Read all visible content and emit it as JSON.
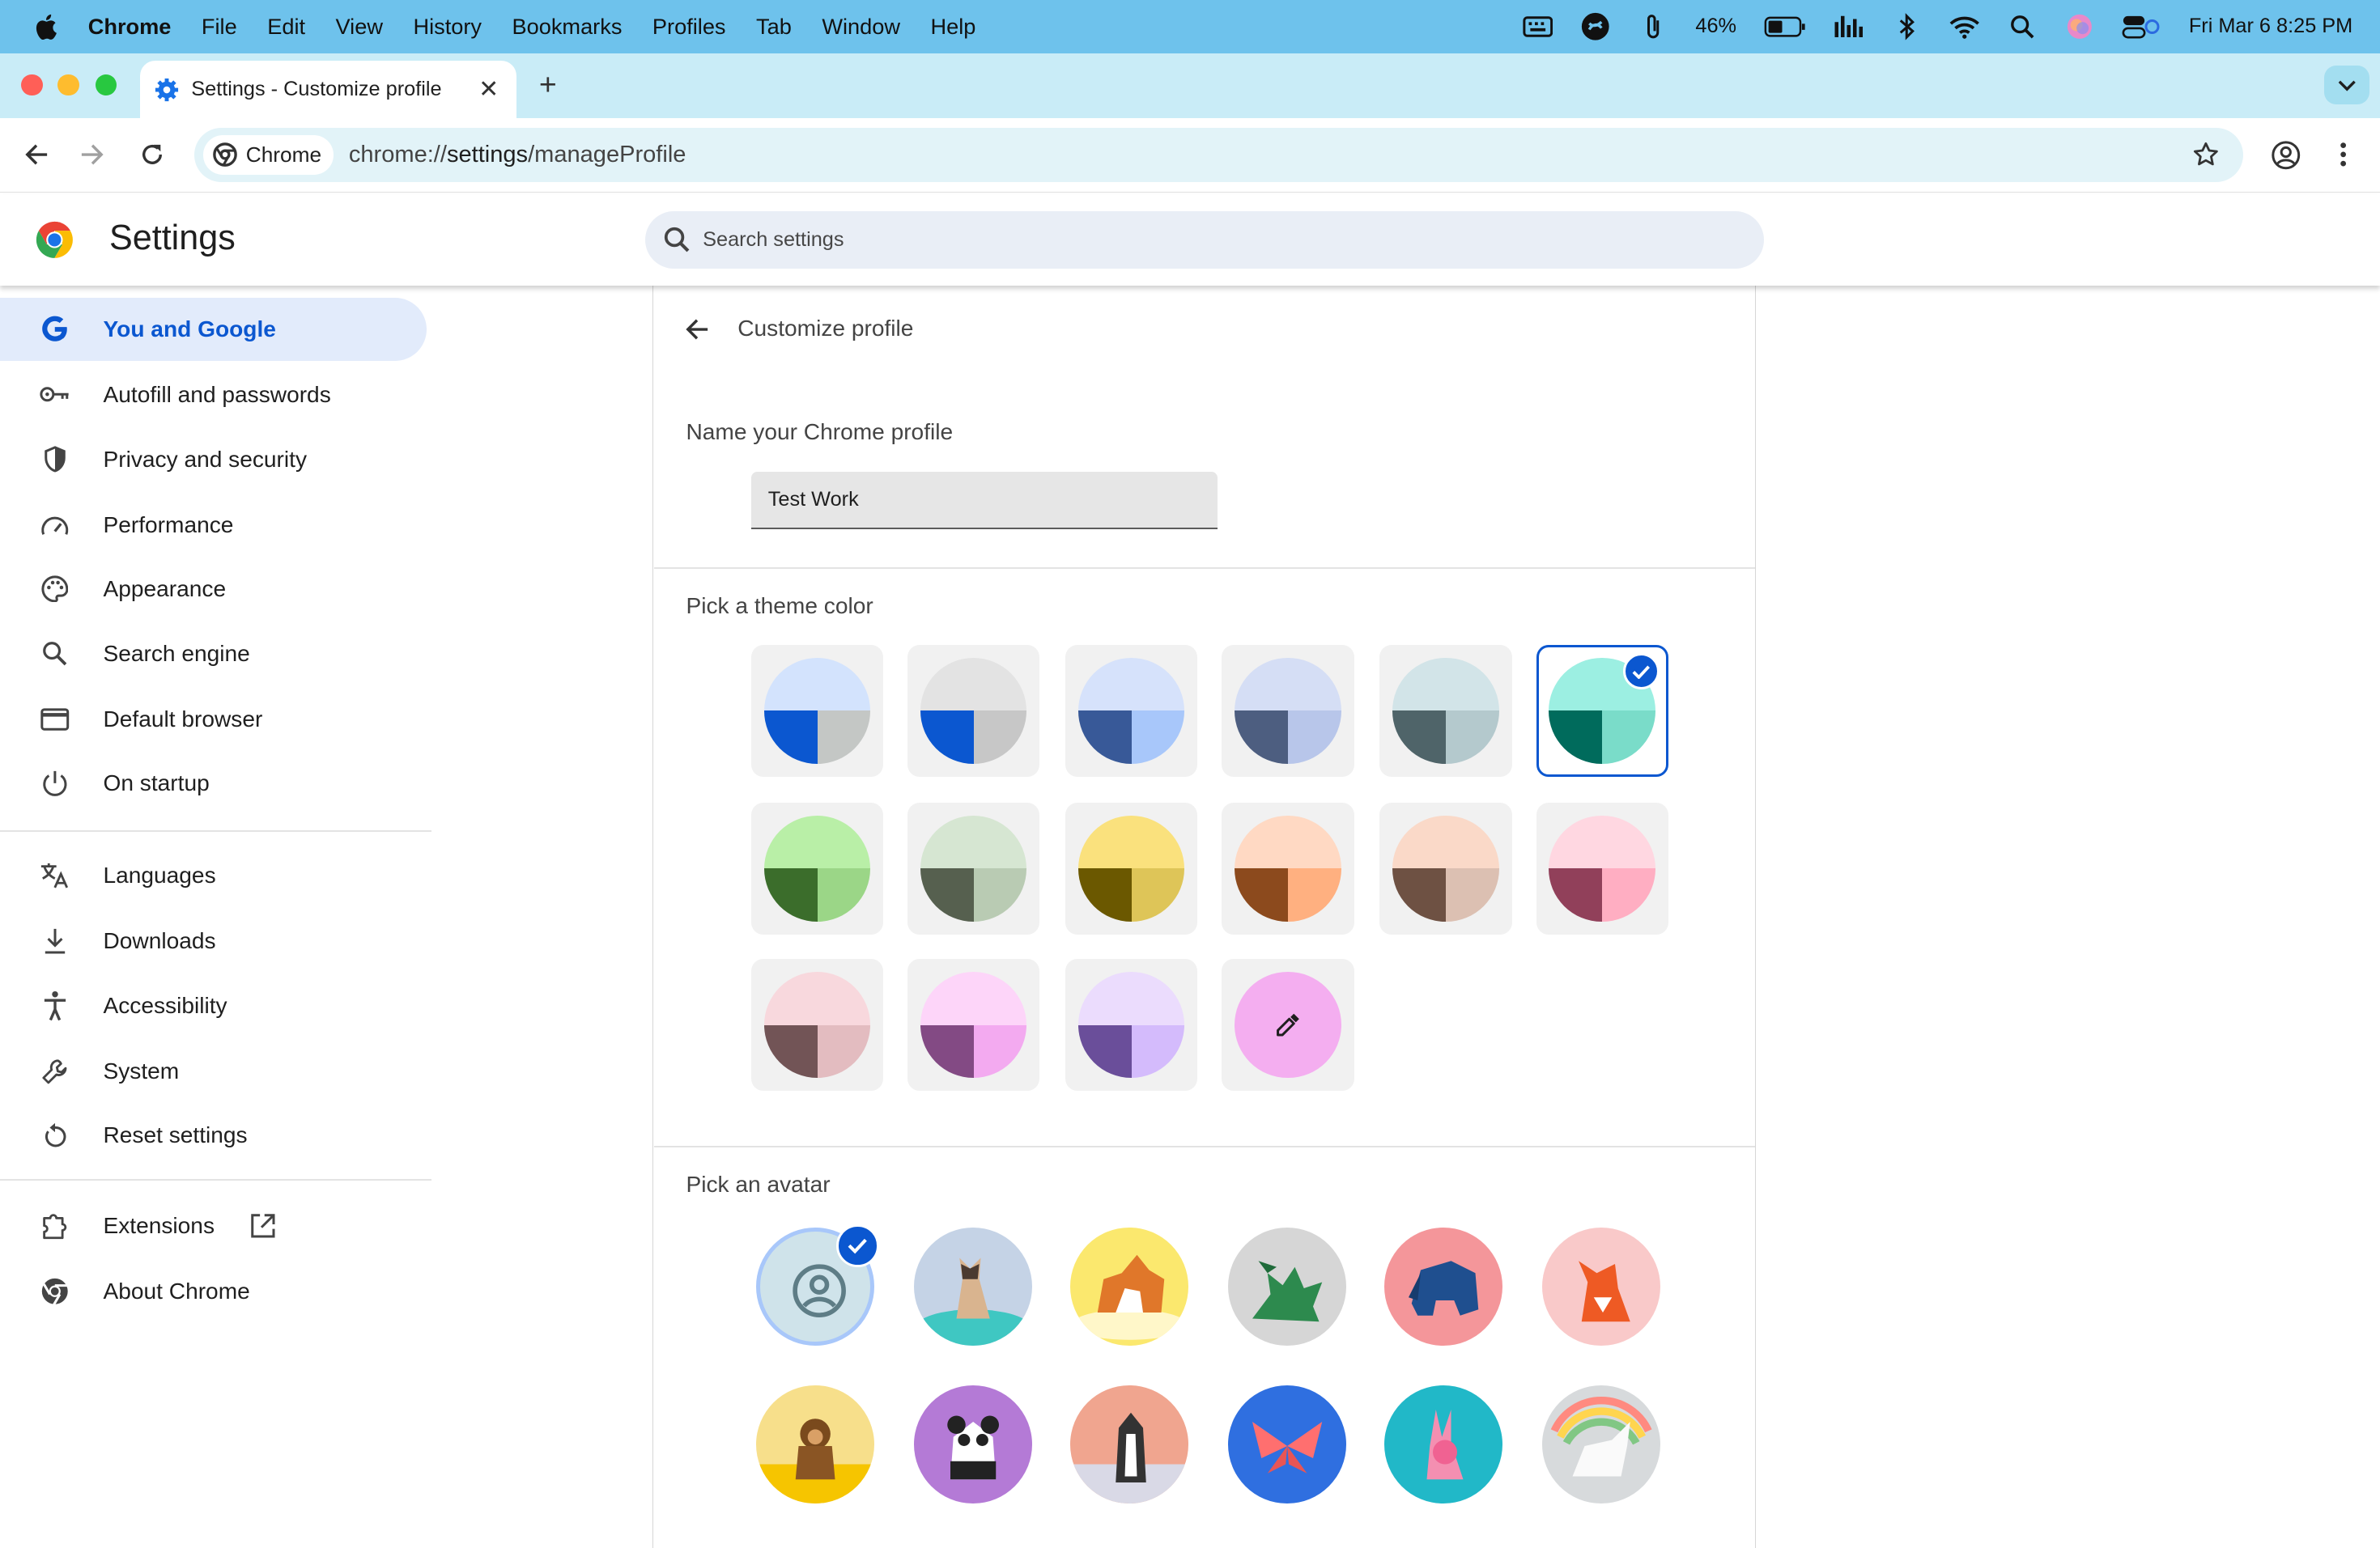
{
  "menubar": {
    "items": [
      "Chrome",
      "File",
      "Edit",
      "View",
      "History",
      "Bookmarks",
      "Profiles",
      "Tab",
      "Window",
      "Help"
    ],
    "battery": "46%",
    "datetime": "Fri Mar 6  8:25 PM"
  },
  "tab": {
    "title": "Settings - Customize profile",
    "close": "✕",
    "new": "+"
  },
  "toolbar": {
    "chip_label": "Chrome",
    "url_prefix": "chrome://",
    "url_host": "settings",
    "url_path": "/manageProfile"
  },
  "header": {
    "title": "Settings",
    "search_placeholder": "Search settings"
  },
  "sidebar": {
    "items": [
      {
        "label": "You and Google",
        "icon": "google-g-icon",
        "active": true
      },
      {
        "label": "Autofill and passwords",
        "icon": "key-icon"
      },
      {
        "label": "Privacy and security",
        "icon": "shield-icon"
      },
      {
        "label": "Performance",
        "icon": "speedometer-icon"
      },
      {
        "label": "Appearance",
        "icon": "palette-icon"
      },
      {
        "label": "Search engine",
        "icon": "search-icon"
      },
      {
        "label": "Default browser",
        "icon": "browser-window-icon"
      },
      {
        "label": "On startup",
        "icon": "power-icon"
      },
      {
        "label": "Languages",
        "icon": "translate-icon"
      },
      {
        "label": "Downloads",
        "icon": "download-icon"
      },
      {
        "label": "Accessibility",
        "icon": "accessibility-icon"
      },
      {
        "label": "System",
        "icon": "wrench-icon"
      },
      {
        "label": "Reset settings",
        "icon": "reset-icon"
      },
      {
        "label": "Extensions",
        "icon": "puzzle-icon"
      },
      {
        "label": "About Chrome",
        "icon": "chrome-icon"
      }
    ]
  },
  "main": {
    "title": "Customize profile",
    "name_label": "Name your Chrome profile",
    "name_value": "Test Work",
    "theme_label": "Pick a theme color",
    "avatar_label": "Pick an avatar",
    "themes": [
      {
        "top": "#d3e3fd",
        "bl": "#0b57d0",
        "br": "#c4c7c5"
      },
      {
        "top": "#e3e3e3",
        "bl": "#0b57d0",
        "br": "#c7c7c7"
      },
      {
        "top": "#d6e2fb",
        "bl": "#385998",
        "br": "#a8c7fa"
      },
      {
        "top": "#d5def5",
        "bl": "#4d5e80",
        "br": "#b8c6ea"
      },
      {
        "top": "#d2e4e8",
        "bl": "#4f6469",
        "br": "#b4c9cd"
      },
      {
        "top": "#9cefe2",
        "bl": "#006b5c",
        "br": "#7adcc9",
        "selected": true
      },
      {
        "top": "#b9efa7",
        "bl": "#3b6d2b",
        "br": "#9bd687"
      },
      {
        "top": "#d6e6d2",
        "bl": "#56604f",
        "br": "#b9cbb3"
      },
      {
        "top": "#fae17d",
        "bl": "#6b5800",
        "br": "#dec558"
      },
      {
        "top": "#ffd9c3",
        "bl": "#8c4a1d",
        "br": "#ffb080"
      },
      {
        "top": "#fad9c8",
        "bl": "#6e5143",
        "br": "#dcc0b2"
      },
      {
        "top": "#ffd7e1",
        "bl": "#91405a",
        "br": "#ffaec2"
      },
      {
        "top": "#f8d8dd",
        "bl": "#725456",
        "br": "#e3bcc0"
      },
      {
        "top": "#fdd5f9",
        "bl": "#834a84",
        "br": "#f3aaf0"
      },
      {
        "top": "#ebdcfd",
        "bl": "#6a4e9a",
        "br": "#d4bbfc"
      }
    ],
    "custom_color": "#f4aef0",
    "avatars": [
      {
        "name": "generic-avatar",
        "bg": "#cfe3ea",
        "selected": true
      },
      {
        "name": "cat-avatar",
        "bg": "#c5d3e6"
      },
      {
        "name": "corgi-avatar",
        "bg": "#fbe86e"
      },
      {
        "name": "dragon-avatar",
        "bg": "#d6d6d6"
      },
      {
        "name": "elephant-avatar",
        "bg": "#f4969a"
      },
      {
        "name": "fox-avatar",
        "bg": "#f9c9c9"
      },
      {
        "name": "monkey-avatar",
        "bg": "#f7df8b"
      },
      {
        "name": "panda-avatar",
        "bg": "#b47ad6"
      },
      {
        "name": "penguin-avatar",
        "bg": "#f0a58f"
      },
      {
        "name": "butterfly-avatar",
        "bg": "#2f6fe0"
      },
      {
        "name": "rabbit-avatar",
        "bg": "#21b8c8"
      },
      {
        "name": "unicorn-avatar",
        "bg": "#d7dadc"
      }
    ]
  }
}
